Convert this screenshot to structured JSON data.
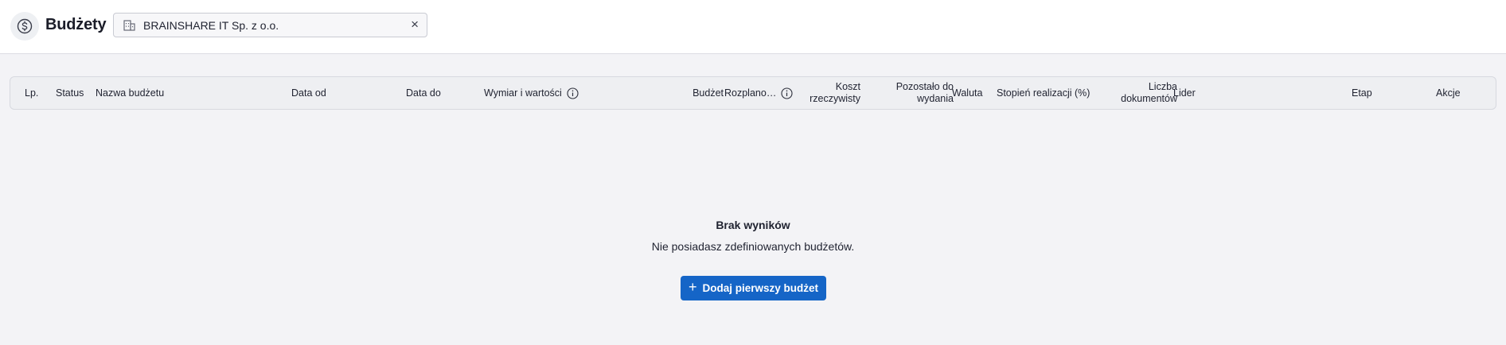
{
  "header": {
    "title": "Budżety",
    "company_chip": {
      "label": "BRAINSHARE IT Sp. z o.o.",
      "clear_symbol": "×"
    }
  },
  "table": {
    "columns": [
      {
        "key": "lp",
        "label": "Lp."
      },
      {
        "key": "status",
        "label": "Status"
      },
      {
        "key": "name",
        "label": "Nazwa budżetu"
      },
      {
        "key": "date_from",
        "label": "Data od"
      },
      {
        "key": "date_to",
        "label": "Data do"
      },
      {
        "key": "dimension",
        "label": "Wymiar i wartości",
        "info_icon": "info-icon"
      },
      {
        "key": "budget",
        "label": "Budżet"
      },
      {
        "key": "planned",
        "label": "Rozplano…",
        "info_icon": "info-icon"
      },
      {
        "key": "actual_cost",
        "label": "Koszt rzeczywisty"
      },
      {
        "key": "remaining",
        "label": "Pozostało do wydania"
      },
      {
        "key": "currency",
        "label": "Waluta"
      },
      {
        "key": "progress",
        "label": "Stopień realizacji (%)"
      },
      {
        "key": "docs",
        "label": "Liczba dokumentów"
      },
      {
        "key": "leader",
        "label": "Lider"
      },
      {
        "key": "stage",
        "label": "Etap"
      },
      {
        "key": "actions",
        "label": "Akcje"
      }
    ]
  },
  "empty_state": {
    "title": "Brak wyników",
    "subtitle": "Nie posiadasz zdefiniowanych budżetów.",
    "button_label": "Dodaj pierwszy budżet"
  },
  "colors": {
    "primary": "#1565c7",
    "background": "#f3f3f6",
    "header_bg": "#ffffff",
    "table_head_bg": "#eeeff2"
  }
}
